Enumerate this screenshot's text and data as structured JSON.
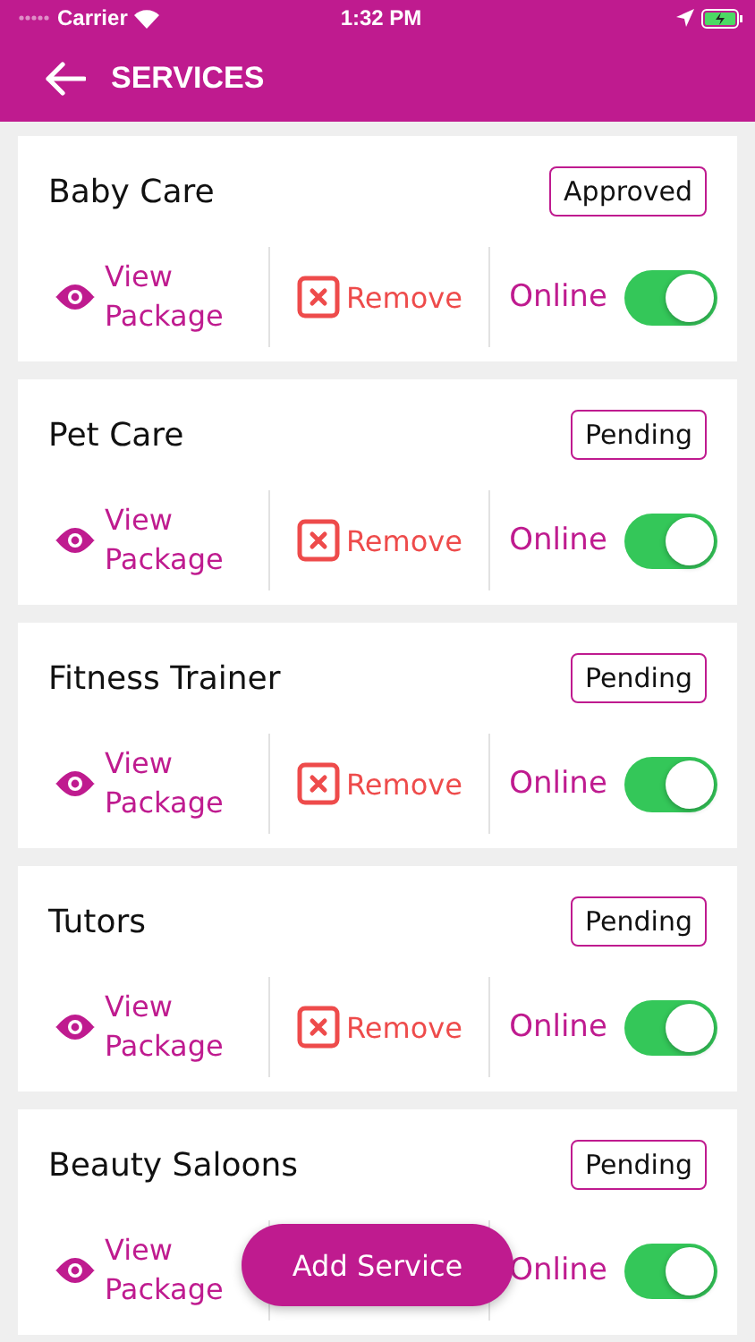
{
  "status_bar": {
    "carrier": "Carrier",
    "time": "1:32 PM"
  },
  "header": {
    "title": "SERVICES"
  },
  "services": [
    {
      "name": "Baby Care",
      "status": "Approved",
      "view_label": "View Package",
      "remove_label": "Remove",
      "online_label": "Online",
      "online": true
    },
    {
      "name": "Pet Care",
      "status": "Pending",
      "view_label": "View Package",
      "remove_label": "Remove",
      "online_label": "Online",
      "online": true
    },
    {
      "name": "Fitness Trainer",
      "status": "Pending",
      "view_label": "View Package",
      "remove_label": "Remove",
      "online_label": "Online",
      "online": true
    },
    {
      "name": "Tutors",
      "status": "Pending",
      "view_label": "View Package",
      "remove_label": "Remove",
      "online_label": "Online",
      "online": true
    },
    {
      "name": "Beauty Saloons",
      "status": "Pending",
      "view_label": "View Package",
      "online_label": "Online",
      "online": true
    }
  ],
  "add_button": "Add Service"
}
